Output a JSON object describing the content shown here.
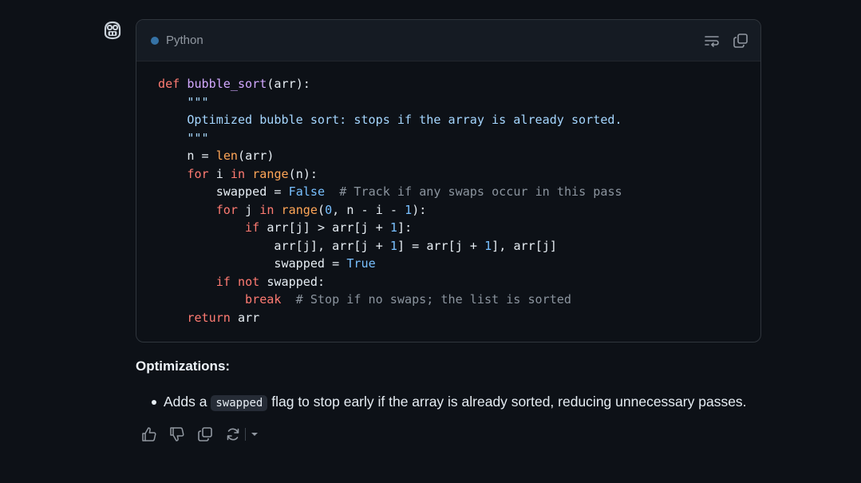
{
  "assistant": {
    "avatar_icon": "copilot-icon"
  },
  "code_block": {
    "language": "Python",
    "language_color": "#3572a5",
    "actions": [
      {
        "name": "wrap-lines-icon"
      },
      {
        "name": "copy-icon"
      }
    ],
    "lines": [
      "def bubble_sort(arr):",
      "    \"\"\"",
      "    Optimized bubble sort: stops if the array is already sorted.",
      "    \"\"\"",
      "    n = len(arr)",
      "    for i in range(n):",
      "        swapped = False  # Track if any swaps occur in this pass",
      "        for j in range(0, n - i - 1):",
      "            if arr[j] > arr[j + 1]:",
      "                arr[j], arr[j + 1] = arr[j + 1], arr[j]",
      "                swapped = True",
      "        if not swapped:",
      "            break  # Stop if no swaps; the list is sorted",
      "    return arr"
    ]
  },
  "response": {
    "heading": "Optimizations:",
    "bullets": [
      {
        "prefix": "Adds a ",
        "code": "swapped",
        "suffix": " flag to stop early if the array is already sorted, reducing unnecessary passes."
      }
    ]
  },
  "message_actions": [
    "thumbs-up-icon",
    "thumbs-down-icon",
    "copy-icon",
    "retry-icon",
    "chevron-down-icon"
  ]
}
